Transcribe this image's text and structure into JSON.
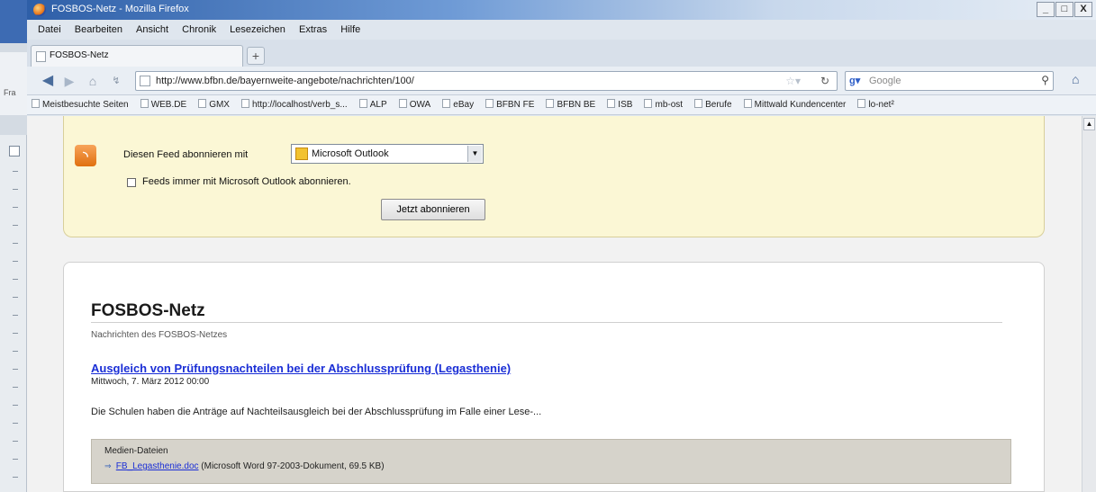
{
  "window": {
    "title": "FOSBOS-Netz - Mozilla Firefox",
    "controls": [
      "_",
      "□",
      "X"
    ]
  },
  "left_peek": {
    "text": "Fra"
  },
  "menu": [
    "Datei",
    "Bearbeiten",
    "Ansicht",
    "Chronik",
    "Lesezeichen",
    "Extras",
    "Hilfe"
  ],
  "tabs": [
    {
      "label": "FOSBOS-Netz"
    }
  ],
  "new_tab": "+",
  "nav": {
    "url": "http://www.bfbn.de/bayernweite-angebote/nachrichten/100/",
    "search_placeholder": "Google",
    "search_engine": "g-logo"
  },
  "bookmarks": [
    "Meistbesuchte Seiten",
    "WEB.DE",
    "GMX",
    "http://localhost/verb_s...",
    "ALP",
    "OWA",
    "eBay",
    "BFBN FE",
    "BFBN BE",
    "ISB",
    "mb-ost",
    "Berufe",
    "Mittwald Kundencenter",
    "lo-net²"
  ],
  "feed": {
    "subscribe_label": "Diesen Feed abonnieren mit",
    "reader_selected": "Microsoft Outlook",
    "always_checkbox_label": "Feeds immer mit Microsoft Outlook abonnieren.",
    "always_checked": false,
    "subscribe_button": "Jetzt abonnieren"
  },
  "article": {
    "heading": "FOSBOS-Netz",
    "subtitle": "Nachrichten des FOSBOS-Netzes",
    "item": {
      "title": "Ausgleich von Prüfungsnachteilen bei der Abschlussprüfung (Legasthenie)",
      "date": "Mittwoch, 7. März 2012 00:00",
      "description": "Die Schulen haben die Anträge auf Nachteilsausgleich bei der Abschlussprüfung im Falle einer Lese-...",
      "media_heading": "Medien-Dateien",
      "attachment_name": "FB_Legasthenie.doc",
      "attachment_info": "(Microsoft Word 97-2003-Dokument, 69.5 KB)"
    }
  }
}
